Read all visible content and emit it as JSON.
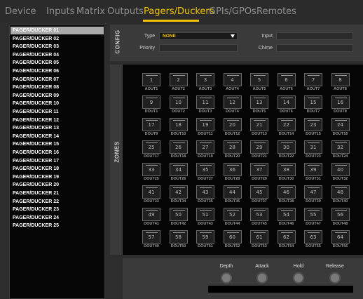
{
  "menu": {
    "tabs": [
      {
        "label": "Device"
      },
      {
        "label": "Inputs"
      },
      {
        "label": "Matrix"
      },
      {
        "label": "Outputs"
      },
      {
        "label": "Pagers/Duckers"
      },
      {
        "label": "GPIs/GPOs"
      },
      {
        "label": "Remotes"
      }
    ],
    "active_tab": "Pagers/Duckers"
  },
  "pagers": {
    "items": [
      "PAGER/DUCKER 01",
      "PAGER/DUCKER 02",
      "PAGER/DUCKER 03",
      "PAGER/DUCKER 04",
      "PAGER/DUCKER 05",
      "PAGER/DUCKER 06",
      "PAGER/DUCKER 07",
      "PAGER/DUCKER 08",
      "PAGER/DUCKER 09",
      "PAGER/DUCKER 10",
      "PAGER/DUCKER 11",
      "PAGER/DUCKER 12",
      "PAGER/DUCKER 13",
      "PAGER/DUCKER 14",
      "PAGER/DUCKER 15",
      "PAGER/DUCKER 16",
      "PAGER/DUCKER 17",
      "PAGER/DUCKER 18",
      "PAGER/DUCKER 19",
      "PAGER/DUCKER 20",
      "PAGER/DUCKER 21",
      "PAGER/DUCKER 22",
      "PAGER/DUCKER 23",
      "PAGER/DUCKER 24",
      "PAGER/DUCKER 25"
    ],
    "selected": "PAGER/DUCKER 01"
  },
  "config": {
    "title": "CONFIG",
    "type_label": "Type",
    "type_value": "NONE",
    "priority_label": "Priority",
    "priority_value": "",
    "input_label": "Input",
    "input_value": "",
    "chime_label": "Chime",
    "chime_value": ""
  },
  "zones": {
    "title": "ZONES",
    "buttons": [
      {
        "num": "1",
        "label": "AOUT1"
      },
      {
        "num": "2",
        "label": "AOUT2"
      },
      {
        "num": "3",
        "label": "AOUT3"
      },
      {
        "num": "4",
        "label": "AOUT4"
      },
      {
        "num": "5",
        "label": "AOUT5"
      },
      {
        "num": "6",
        "label": "AOUT6"
      },
      {
        "num": "7",
        "label": "AOUT7"
      },
      {
        "num": "8",
        "label": "AOUT8"
      },
      {
        "num": "9",
        "label": "DOUT1"
      },
      {
        "num": "10",
        "label": "DOUT2"
      },
      {
        "num": "11",
        "label": "DOUT3"
      },
      {
        "num": "12",
        "label": "DOUT4"
      },
      {
        "num": "13",
        "label": "DOUT5"
      },
      {
        "num": "14",
        "label": "DOUT6"
      },
      {
        "num": "15",
        "label": "DOUT7"
      },
      {
        "num": "16",
        "label": "DOUT8"
      },
      {
        "num": "17",
        "label": "DOUT9"
      },
      {
        "num": "18",
        "label": "DOUT10"
      },
      {
        "num": "19",
        "label": "DOUT11"
      },
      {
        "num": "20",
        "label": "DOUT12"
      },
      {
        "num": "21",
        "label": "DOUT13"
      },
      {
        "num": "22",
        "label": "DOUT14"
      },
      {
        "num": "23",
        "label": "DOUT15"
      },
      {
        "num": "24",
        "label": "DOUT16"
      },
      {
        "num": "25",
        "label": "DOUT17"
      },
      {
        "num": "26",
        "label": "DOUT18"
      },
      {
        "num": "27",
        "label": "DOUT19"
      },
      {
        "num": "28",
        "label": "DOUT20"
      },
      {
        "num": "29",
        "label": "DOUT21"
      },
      {
        "num": "30",
        "label": "DOUT22"
      },
      {
        "num": "31",
        "label": "DOUT23"
      },
      {
        "num": "32",
        "label": "DOUT24"
      },
      {
        "num": "33",
        "label": "DOUT25"
      },
      {
        "num": "34",
        "label": "DOUT26"
      },
      {
        "num": "35",
        "label": "DOUT27"
      },
      {
        "num": "36",
        "label": "DOUT28"
      },
      {
        "num": "37",
        "label": "DOUT29"
      },
      {
        "num": "38",
        "label": "DOUT30"
      },
      {
        "num": "39",
        "label": "DOUT31"
      },
      {
        "num": "40",
        "label": "DOUT32"
      },
      {
        "num": "41",
        "label": "DOUT33"
      },
      {
        "num": "42",
        "label": "DOUT34"
      },
      {
        "num": "43",
        "label": "DOUT35"
      },
      {
        "num": "44",
        "label": "DOUT36"
      },
      {
        "num": "45",
        "label": "DOUT37"
      },
      {
        "num": "46",
        "label": "DOUT38"
      },
      {
        "num": "47",
        "label": "DOUT39"
      },
      {
        "num": "48",
        "label": "DOUT40"
      },
      {
        "num": "49",
        "label": "DOUT41"
      },
      {
        "num": "50",
        "label": "DOUT42"
      },
      {
        "num": "51",
        "label": "DOUT43"
      },
      {
        "num": "52",
        "label": "DOUT44"
      },
      {
        "num": "53",
        "label": "DOUT45"
      },
      {
        "num": "54",
        "label": "DOUT46"
      },
      {
        "num": "55",
        "label": "DOUT47"
      },
      {
        "num": "56",
        "label": "DOUT48"
      },
      {
        "num": "57",
        "label": "DOUT49"
      },
      {
        "num": "58",
        "label": "DOUT50"
      },
      {
        "num": "59",
        "label": "DOUT51"
      },
      {
        "num": "60",
        "label": "DOUT52"
      },
      {
        "num": "61",
        "label": "DOUT53"
      },
      {
        "num": "62",
        "label": "DOUT54"
      },
      {
        "num": "63",
        "label": "DOUT55"
      },
      {
        "num": "64",
        "label": "DOUT56"
      }
    ]
  },
  "controls": {
    "knobs": [
      {
        "label": "Depth",
        "value": ""
      },
      {
        "label": "Attack",
        "value": ""
      },
      {
        "label": "Hold",
        "value": ""
      },
      {
        "label": "Release",
        "value": ""
      }
    ]
  },
  "colors": {
    "accent": "#f2c200",
    "background": "#2d2d2d",
    "panel": "#3a3a3a",
    "list_background": "#050505",
    "selected_item": "#a9a9a9"
  }
}
